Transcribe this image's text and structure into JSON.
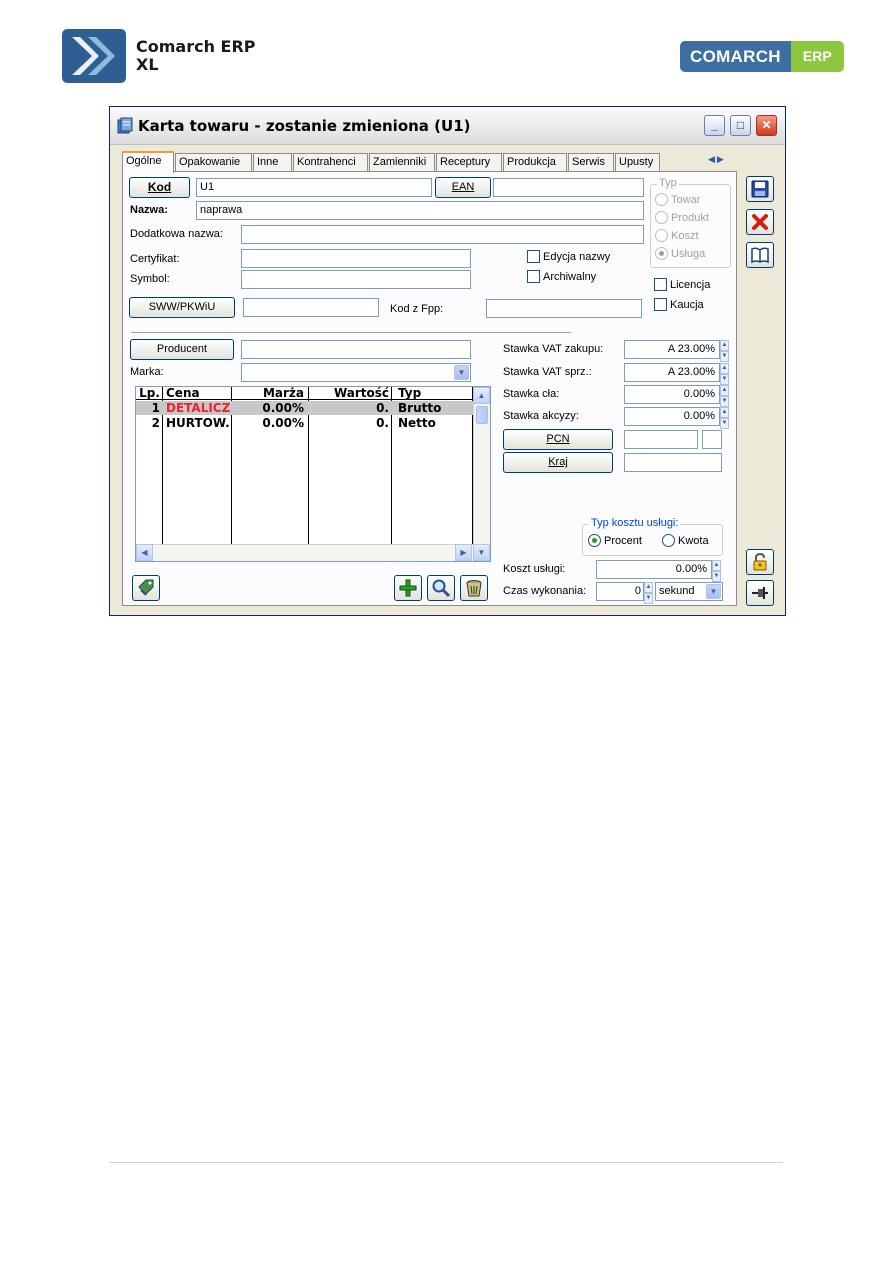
{
  "doc_header": {
    "product_line1": "Comarch ERP",
    "product_line2": "XL",
    "brand_main": "COMARCH",
    "brand_sub": "ERP"
  },
  "window": {
    "title": "Karta towaru - zostanie zmieniona (U1)"
  },
  "tabs": [
    "Ogólne",
    "Opakowanie",
    "Inne",
    "Kontrahenci",
    "Zamienniki",
    "Receptury",
    "Produkcja",
    "Serwis",
    "Upusty"
  ],
  "form": {
    "kod_button": "Kod",
    "kod_value": "U1",
    "ean_button": "EAN",
    "ean_value": "",
    "nazwa_label": "Nazwa:",
    "nazwa_value": "naprawa",
    "dodatkowa_label": "Dodatkowa nazwa:",
    "dodatkowa_value": "",
    "certyfikat_label": "Certyfikat:",
    "certyfikat_value": "",
    "symbol_label": "Symbol:",
    "symbol_value": "",
    "sww_button": "SWW/PKWiU",
    "sww_value": "",
    "kod_fpp_label": "Kod z Fpp:",
    "kod_fpp_value": "",
    "edycja_nazwy": "Edycja nazwy",
    "archiwalny": "Archiwalny",
    "typ_title": "Typ",
    "typ_options": [
      "Towar",
      "Produkt",
      "Koszt",
      "Usługa"
    ],
    "typ_selected": "Usługa",
    "licencja": "Licencja",
    "kaucja": "Kaucja",
    "producent_button": "Producent",
    "producent_value": "",
    "marka_label": "Marka:",
    "marka_value": "",
    "vat_zakupu_label": "Stawka VAT zakupu:",
    "vat_zakupu_value": "A 23.00%",
    "vat_sprz_label": "Stawka VAT sprz.:",
    "vat_sprz_value": "A 23.00%",
    "clo_label": "Stawka cła:",
    "clo_value": "0.00%",
    "akcyza_label": "Stawka akcyzy:",
    "akcyza_value": "0.00%",
    "pcn_button": "PCN",
    "kraj_button": "Kraj",
    "typ_kosztu_title": "Typ kosztu usługi:",
    "typ_kosztu_options": [
      "Procent",
      "Kwota"
    ],
    "typ_kosztu_selected": "Procent",
    "koszt_uslugi_label": "Koszt usługi:",
    "koszt_uslugi_value": "0.00%",
    "czas_label": "Czas wykonania:",
    "czas_value": "0",
    "czas_unit": "sekund"
  },
  "price_grid": {
    "columns": [
      "Lp.",
      "Cena",
      "Marża",
      "Wartość",
      "Typ"
    ],
    "rows": [
      {
        "lp": "1",
        "cena": "DETALICZ",
        "marza": "0.00%",
        "wartosc": "0.",
        "typ": "Brutto"
      },
      {
        "lp": "2",
        "cena": "HURTOW.",
        "marza": "0.00%",
        "wartosc": "0.",
        "typ": "Netto"
      }
    ],
    "highlight_color": "#e8232a"
  },
  "colors": {
    "window_bg": "#ece9d8",
    "panel_bg": "#fcfcfe",
    "tab_active_accent": "#f0a030",
    "brand_blue": "#3d6fa0",
    "brand_green": "#8dc63f"
  }
}
